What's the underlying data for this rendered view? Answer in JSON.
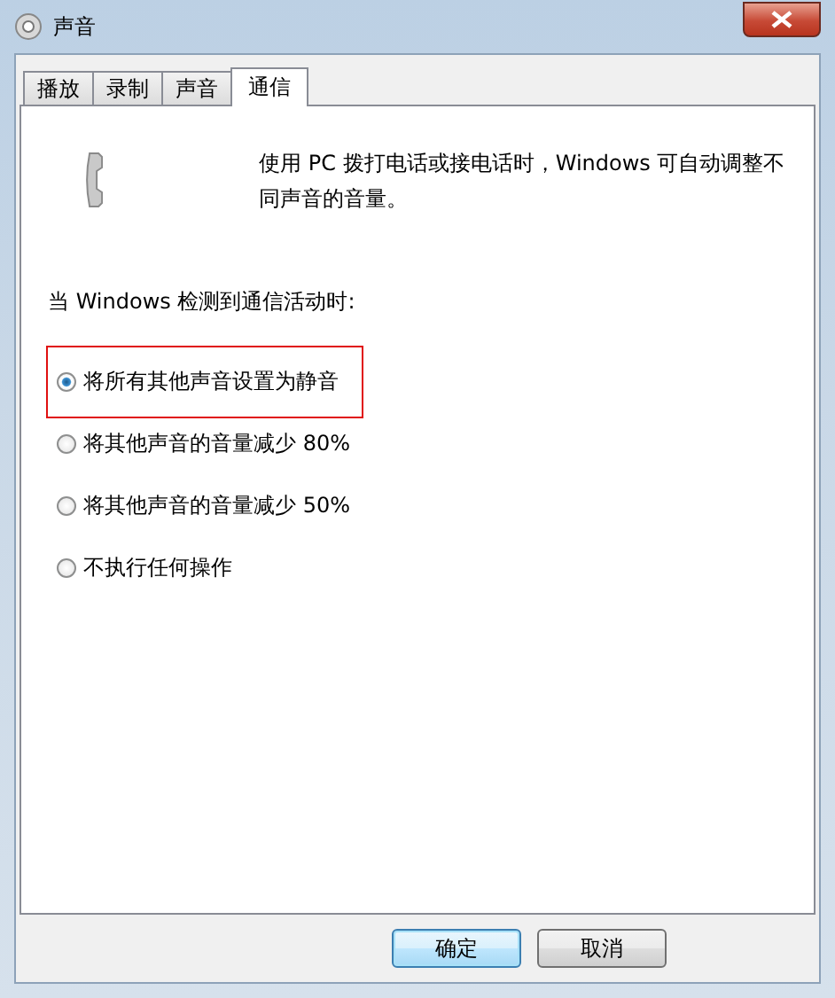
{
  "window": {
    "title": "声音"
  },
  "tabs": [
    {
      "label": "播放",
      "selected": false
    },
    {
      "label": "录制",
      "selected": false
    },
    {
      "label": "声音",
      "selected": false
    },
    {
      "label": "通信",
      "selected": true
    }
  ],
  "description": "使用 PC 拨打电话或接电话时，Windows 可自动调整不同声音的音量。",
  "heading": "当 Windows 检测到通信活动时:",
  "options": [
    {
      "label": "将所有其他声音设置为静音",
      "selected": true
    },
    {
      "label": "将其他声音的音量减少 80%",
      "selected": false
    },
    {
      "label": "将其他声音的音量减少 50%",
      "selected": false
    },
    {
      "label": "不执行任何操作",
      "selected": false
    }
  ],
  "buttons": [
    {
      "label": "确定",
      "default": true
    },
    {
      "label": "取消",
      "default": false
    }
  ]
}
